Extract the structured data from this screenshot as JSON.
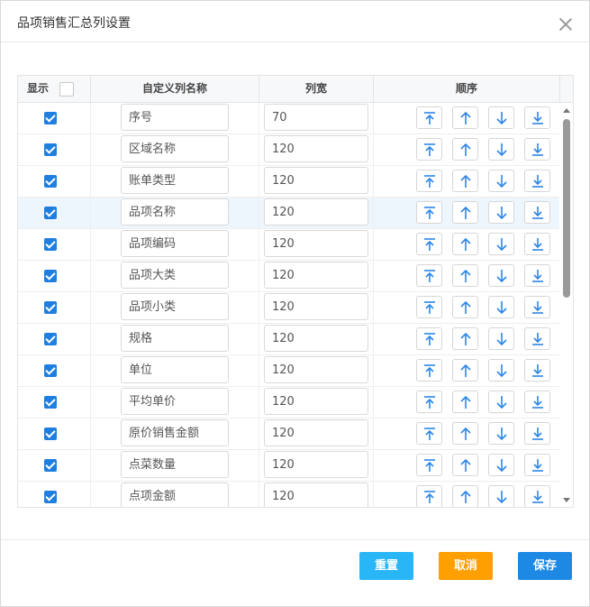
{
  "dialog": {
    "title": "品项销售汇总列设置"
  },
  "table": {
    "headers": {
      "show": "显示",
      "name": "自定义列名称",
      "width": "列宽",
      "order": "顺序"
    },
    "rows": [
      {
        "checked": true,
        "name": "序号",
        "width": "70"
      },
      {
        "checked": true,
        "name": "区域名称",
        "width": "120"
      },
      {
        "checked": true,
        "name": "账单类型",
        "width": "120"
      },
      {
        "checked": true,
        "name": "品项名称",
        "width": "120",
        "highlighted": true
      },
      {
        "checked": true,
        "name": "品项编码",
        "width": "120"
      },
      {
        "checked": true,
        "name": "品项大类",
        "width": "120"
      },
      {
        "checked": true,
        "name": "品项小类",
        "width": "120"
      },
      {
        "checked": true,
        "name": "规格",
        "width": "120"
      },
      {
        "checked": true,
        "name": "单位",
        "width": "120"
      },
      {
        "checked": true,
        "name": "平均单价",
        "width": "120"
      },
      {
        "checked": true,
        "name": "原价销售金额",
        "width": "120"
      },
      {
        "checked": true,
        "name": "点菜数量",
        "width": "120"
      },
      {
        "checked": true,
        "name": "点项金额",
        "width": "120"
      }
    ],
    "order_icons": [
      "move-top-icon",
      "move-up-icon",
      "move-down-icon",
      "move-bottom-icon"
    ]
  },
  "footer": {
    "reset": "重置",
    "cancel": "取消",
    "save": "保存"
  },
  "colors": {
    "checkbox": "#1f7fe0",
    "icon": "#2c86e6",
    "reset": "#29b6f6",
    "cancel": "#ff9f00",
    "save": "#1e88e5"
  }
}
